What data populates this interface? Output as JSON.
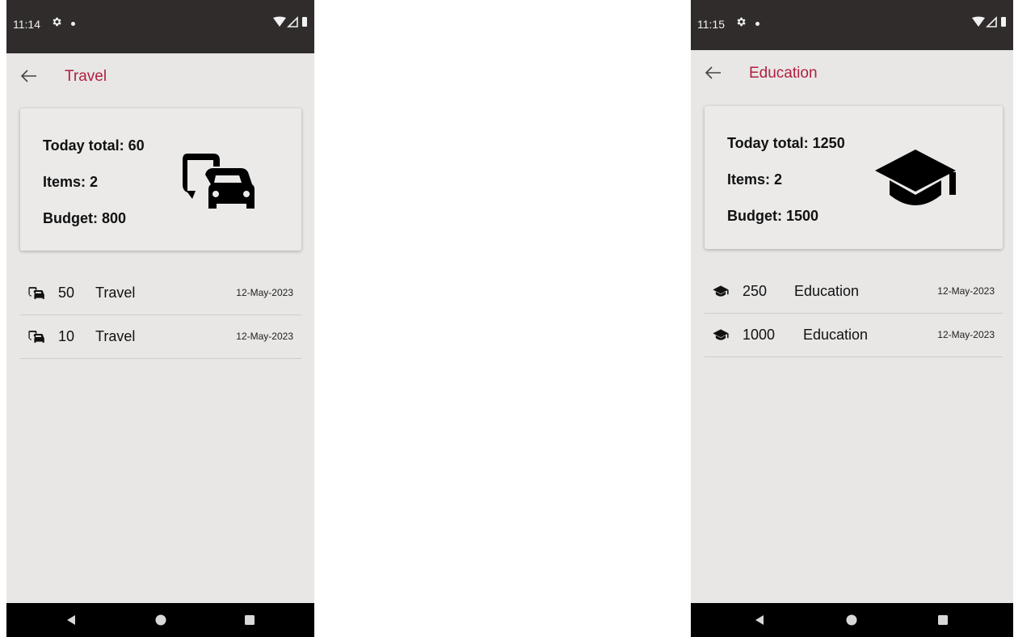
{
  "screens": [
    {
      "status_time": "11:14",
      "title": "Travel",
      "icon": "commute-icon",
      "summary": {
        "today_total": "Today total: 60",
        "items": "Items: 2",
        "budget": "Budget: 800"
      },
      "entries": [
        {
          "amount": "50",
          "category": "Travel",
          "date": "12-May-2023"
        },
        {
          "amount": "10",
          "category": "Travel",
          "date": "12-May-2023"
        }
      ]
    },
    {
      "status_time": "11:15",
      "title": "Education",
      "icon": "school-icon",
      "summary": {
        "today_total": "Today total: 1250",
        "items": "Items: 2",
        "budget": "Budget: 1500"
      },
      "entries": [
        {
          "amount": "250",
          "category": "Education",
          "date": "12-May-2023"
        },
        {
          "amount": "1000",
          "category": "Education",
          "date": "12-May-2023"
        }
      ]
    }
  ],
  "colors": {
    "title_accent": "#b0203f",
    "status_bar": "#302c2c",
    "background": "#e8e7e6",
    "nav_bar": "#000000"
  }
}
